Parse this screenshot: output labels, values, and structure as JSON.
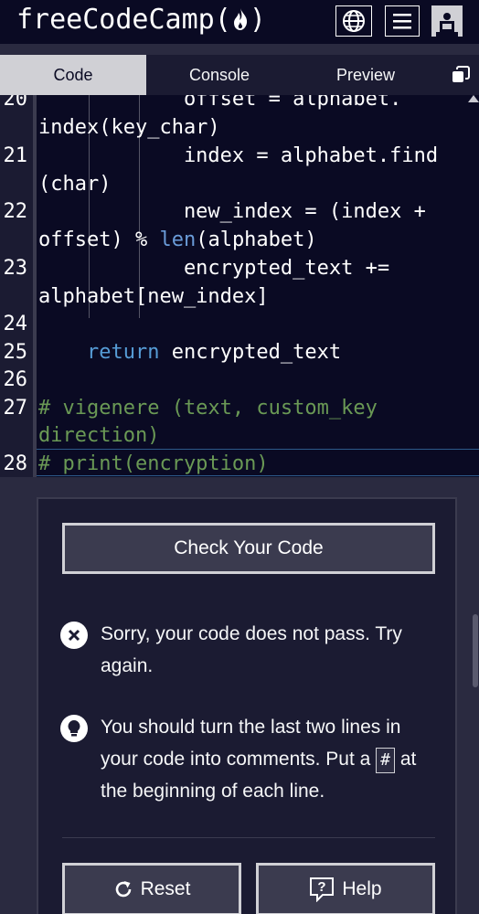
{
  "header": {
    "brand": "freeCodeCamp(",
    "brand_end": ")",
    "flame_icon": "flame-icon",
    "globe_icon": "globe-icon",
    "menu_icon": "menu-icon",
    "avatar_icon": "avatar-icon"
  },
  "tabs": [
    {
      "label": "Code",
      "active": true
    },
    {
      "label": "Console",
      "active": false
    },
    {
      "label": "Preview",
      "active": false
    }
  ],
  "tabs_popout_icon": "popout-icon",
  "editor": {
    "lines": [
      {
        "number": "20",
        "text": "            offset = alphabet.",
        "cont": "index(key_char)"
      },
      {
        "number": "21",
        "text": "            index = alphabet.find",
        "cont": "(char)"
      },
      {
        "number": "22",
        "text": "            new_index = (index +",
        "cont_pre": "offset) % ",
        "cont_fn": "len",
        "cont_post": "(alphabet)"
      },
      {
        "number": "23",
        "text": "            encrypted_text +=",
        "cont": "alphabet[new_index]"
      },
      {
        "number": "24",
        "text": ""
      },
      {
        "number": "25",
        "kw": "return",
        "text": " encrypted_text",
        "indent": "    "
      },
      {
        "number": "26",
        "text": ""
      },
      {
        "number": "27",
        "comment": "# vigenere (text, custom_key",
        "cont_comment": "direction)"
      },
      {
        "number": "28",
        "comment": "# print(encryption)"
      }
    ]
  },
  "panel": {
    "check_button": "Check Your Code",
    "fail_message": "Sorry, your code does not pass. Try again.",
    "hint_before": "You should turn the last two lines in your code into comments. Put a ",
    "hint_code": "#",
    "hint_after": " at the beginning of each line.",
    "reset_button": "Reset",
    "help_button": "Help"
  },
  "colors": {
    "background": "#0a0a23",
    "panel": "#1b1b32",
    "keyword": "#569cd6",
    "comment": "#6a9955"
  }
}
